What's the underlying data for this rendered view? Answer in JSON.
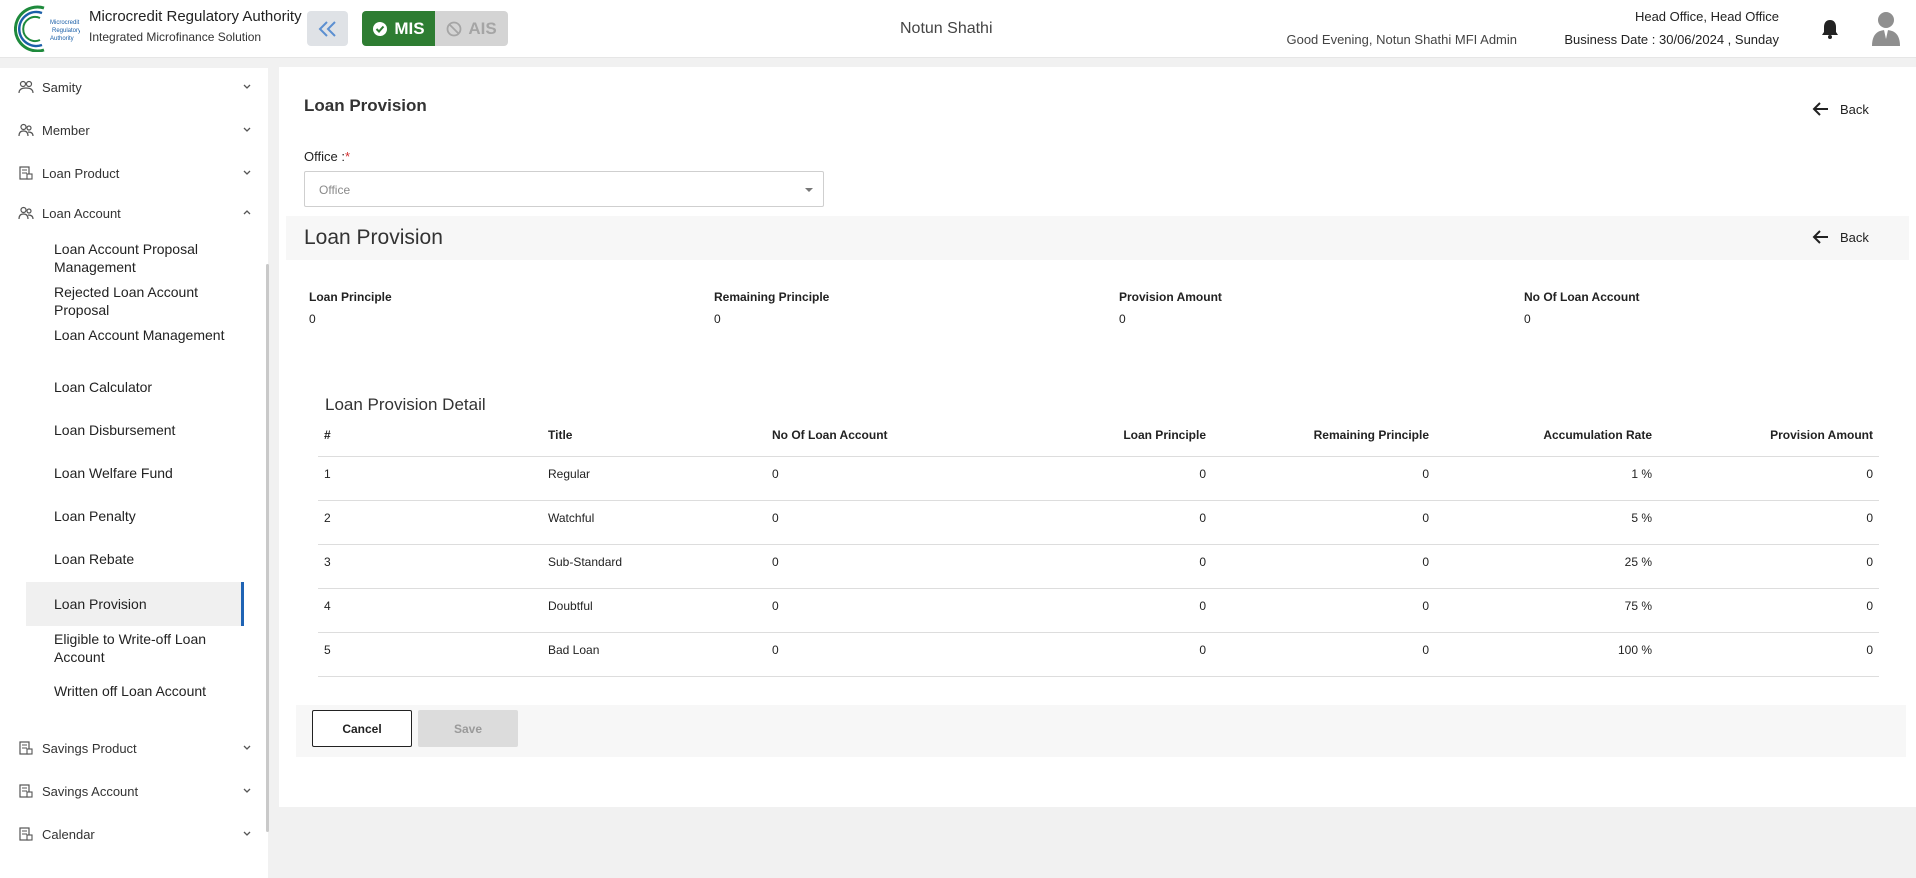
{
  "header": {
    "brand_title": "Microcredit Regulatory Authority",
    "brand_sub": "Integrated Microfinance Solution",
    "logo_text": "Microcredit Regulatory Authority",
    "mis_label": "MIS",
    "ais_label": "AIS",
    "org_name": "Notun Shathi",
    "greeting": "Good Evening, Notun Shathi MFI Admin",
    "office": "Head Office, Head Office",
    "business_date": "Business Date : 30/06/2024 , Sunday",
    "accent_green": "#2e7d32"
  },
  "sidebar": {
    "groups": [
      {
        "label": "Samity",
        "icon": "samity-icon"
      },
      {
        "label": "Member",
        "icon": "member-icon"
      },
      {
        "label": "Loan Product",
        "icon": "product-icon"
      },
      {
        "label": "Loan Account",
        "icon": "member-icon"
      },
      {
        "label": "Savings Product",
        "icon": "product-icon"
      },
      {
        "label": "Savings Account",
        "icon": "product-icon"
      },
      {
        "label": "Calendar",
        "icon": "product-icon"
      }
    ],
    "sub_items": [
      "Loan Account Proposal Management",
      "Rejected Loan Account Proposal",
      "Loan Account Management",
      "Loan Calculator",
      "Loan Disbursement",
      "Loan Welfare Fund",
      "Loan Penalty",
      "Loan Rebate",
      "Loan Provision",
      "Eligible to Write-off Loan Account",
      "Written off Loan Account"
    ],
    "active": "Loan Provision"
  },
  "main": {
    "page_title": "Loan Provision",
    "back_label": "Back",
    "office_label": "Office :",
    "office_required": "*",
    "office_placeholder": "Office",
    "section_title": "Loan Provision",
    "stats": [
      {
        "label": "Loan Principle",
        "value": "0"
      },
      {
        "label": "Remaining Principle",
        "value": "0"
      },
      {
        "label": "Provision Amount",
        "value": "0"
      },
      {
        "label": "No Of Loan Account",
        "value": "0"
      }
    ],
    "detail_title": "Loan Provision Detail",
    "columns": [
      "#",
      "Title",
      "No Of Loan Account",
      "Loan Principle",
      "Remaining Principle",
      "Accumulation Rate",
      "Provision Amount"
    ],
    "rows": [
      [
        "1",
        "Regular",
        "0",
        "0",
        "0",
        "1 %",
        "0"
      ],
      [
        "2",
        "Watchful",
        "0",
        "0",
        "0",
        "5 %",
        "0"
      ],
      [
        "3",
        "Sub-Standard",
        "0",
        "0",
        "0",
        "25 %",
        "0"
      ],
      [
        "4",
        "Doubtful",
        "0",
        "0",
        "0",
        "75 %",
        "0"
      ],
      [
        "5",
        "Bad Loan",
        "0",
        "0",
        "0",
        "100 %",
        "0"
      ]
    ],
    "cancel_label": "Cancel",
    "save_label": "Save"
  }
}
